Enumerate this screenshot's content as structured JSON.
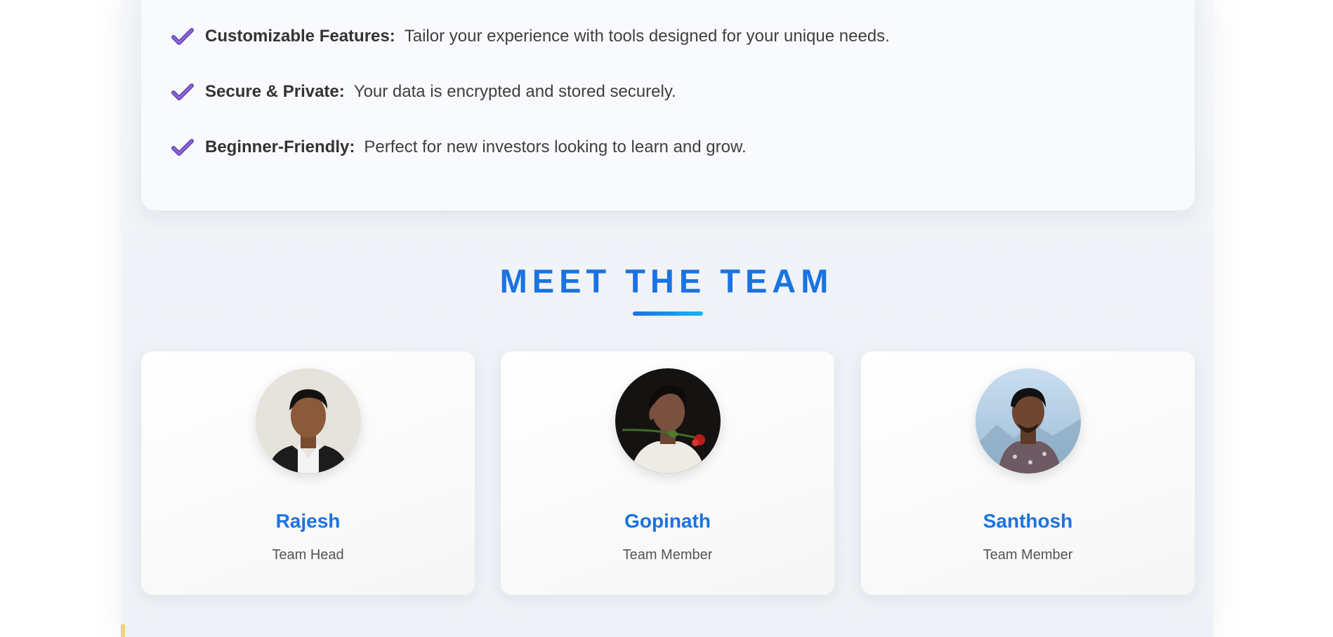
{
  "features": [
    {
      "label": "Customizable Features:",
      "description": "Tailor your experience with tools designed for your unique needs.",
      "icon": "checkmark-icon"
    },
    {
      "label": "Secure & Private:",
      "description": "Your data is encrypted and stored securely.",
      "icon": "checkmark-icon"
    },
    {
      "label": "Beginner-Friendly:",
      "description": "Perfect for new investors looking to learn and grow.",
      "icon": "checkmark-icon"
    }
  ],
  "team_section": {
    "title": "MEET THE TEAM",
    "members": [
      {
        "name": "Rajesh",
        "role": "Team Head"
      },
      {
        "name": "Gopinath",
        "role": "Team Member"
      },
      {
        "name": "Santhosh",
        "role": "Team Member"
      }
    ]
  },
  "colors": {
    "accent": "#1a73e3",
    "check": "#7b52c9",
    "underline_start": "#1a6fe6",
    "underline_end": "#17b4f2"
  }
}
